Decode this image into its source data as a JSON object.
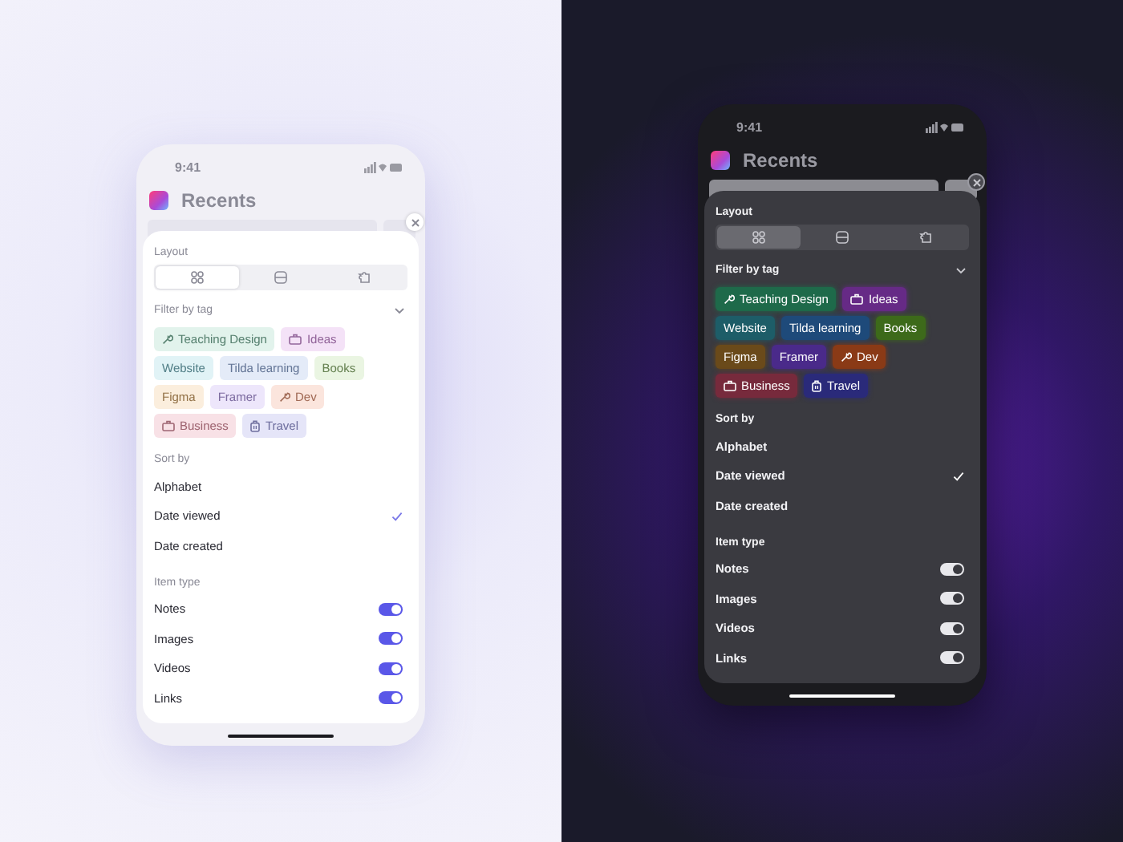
{
  "phones": [
    {
      "kind": "light",
      "time": "9:41",
      "title": "Recents",
      "layout": {
        "label": "Layout",
        "options": [
          {
            "kind": "grid",
            "selected": true
          },
          {
            "kind": "list",
            "selected": false
          },
          {
            "kind": "puzzle",
            "selected": false
          }
        ]
      },
      "filter": {
        "label": "Filter by tag",
        "tags": [
          {
            "label": "Teaching Design",
            "kind": "tool",
            "color": "#e2f3ec"
          },
          {
            "label": "Ideas",
            "kind": "bag",
            "color": "#f4e2f7"
          },
          {
            "label": "Website",
            "kind": "plain",
            "color": "#e1f3f6"
          },
          {
            "label": "Tilda learning",
            "kind": "plain",
            "color": "#e4ebf8"
          },
          {
            "label": "Books",
            "kind": "plain",
            "color": "#eaf5e2"
          },
          {
            "label": "Figma",
            "kind": "plain",
            "color": "#fbeedd"
          },
          {
            "label": "Framer",
            "kind": "plain",
            "color": "#ede6fb"
          },
          {
            "label": "Dev",
            "kind": "tool",
            "color": "#fbe5dd"
          },
          {
            "label": "Business",
            "kind": "bag",
            "color": "#f8e1e6"
          },
          {
            "label": "Travel",
            "kind": "suitcase",
            "color": "#e5e5f8"
          }
        ]
      },
      "sort": {
        "label": "Sort by",
        "options": [
          {
            "label": "Alphabet",
            "selected": false
          },
          {
            "label": "Date viewed",
            "selected": true
          },
          {
            "label": "Date created",
            "selected": false
          }
        ]
      },
      "item_type": {
        "label": "Item type",
        "items": [
          {
            "label": "Notes",
            "on": true
          },
          {
            "label": "Images",
            "on": true
          },
          {
            "label": "Videos",
            "on": true
          },
          {
            "label": "Links",
            "on": true
          }
        ]
      }
    },
    {
      "kind": "dark",
      "time": "9:41",
      "title": "Recents",
      "layout": {
        "label": "Layout",
        "options": [
          {
            "kind": "grid",
            "selected": true
          },
          {
            "kind": "list",
            "selected": false
          },
          {
            "kind": "puzzle",
            "selected": false
          }
        ]
      },
      "filter": {
        "label": "Filter by tag",
        "tags": [
          {
            "label": "Teaching Design",
            "kind": "tool",
            "color": "#1e6a4a"
          },
          {
            "label": "Ideas",
            "kind": "bag",
            "color": "#662a86"
          },
          {
            "label": "Website",
            "kind": "plain",
            "color": "#1d5d68"
          },
          {
            "label": "Tilda learning",
            "kind": "plain",
            "color": "#1e4a7a"
          },
          {
            "label": "Books",
            "kind": "plain",
            "color": "#3d6a1a"
          },
          {
            "label": "Figma",
            "kind": "plain",
            "color": "#6a4a1a"
          },
          {
            "label": "Framer",
            "kind": "plain",
            "color": "#4a2a8a"
          },
          {
            "label": "Dev",
            "kind": "tool",
            "color": "#8a3a16"
          },
          {
            "label": "Business",
            "kind": "bag",
            "color": "#772a3c"
          },
          {
            "label": "Travel",
            "kind": "suitcase",
            "color": "#2a2a7a"
          }
        ]
      },
      "sort": {
        "label": "Sort by",
        "options": [
          {
            "label": "Alphabet",
            "selected": false
          },
          {
            "label": "Date viewed",
            "selected": true
          },
          {
            "label": "Date created",
            "selected": false
          }
        ]
      },
      "item_type": {
        "label": "Item type",
        "items": [
          {
            "label": "Notes",
            "on": true
          },
          {
            "label": "Images",
            "on": true
          },
          {
            "label": "Videos",
            "on": true
          },
          {
            "label": "Links",
            "on": true
          }
        ]
      }
    }
  ]
}
